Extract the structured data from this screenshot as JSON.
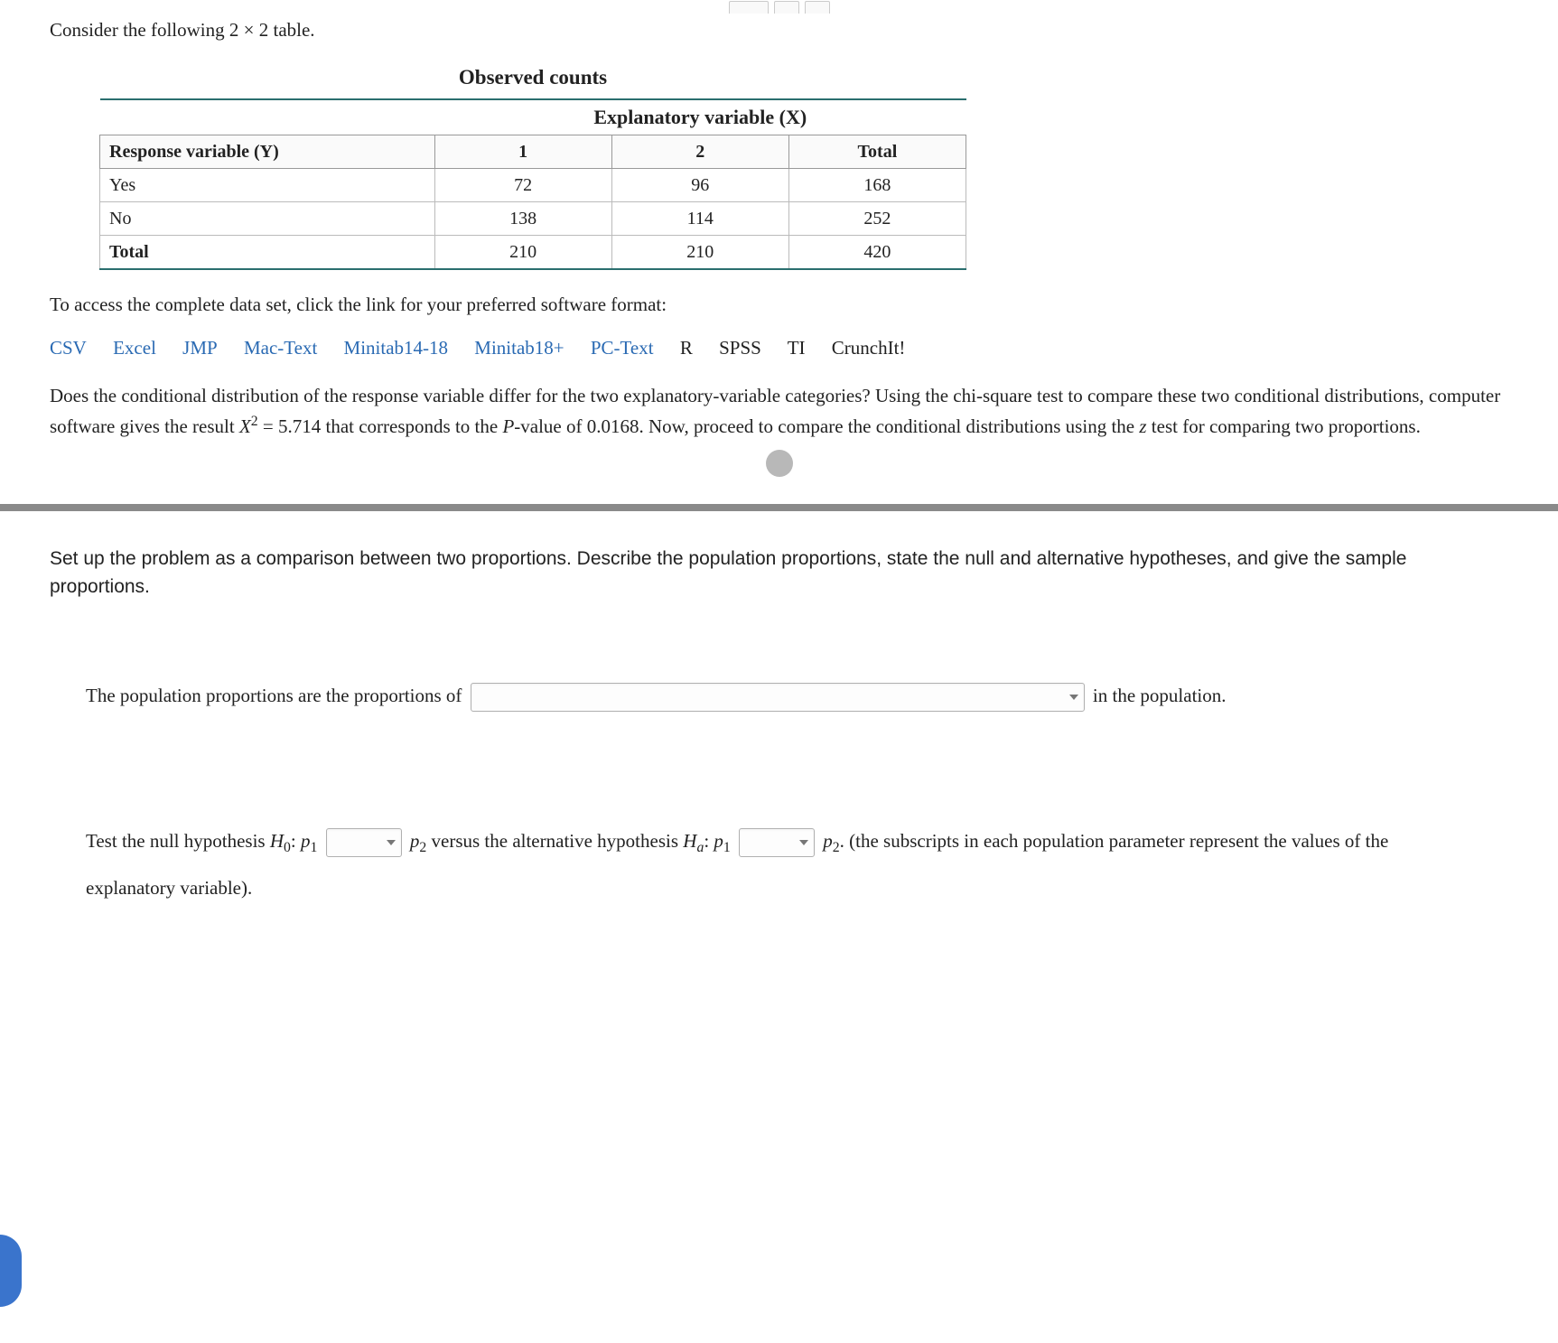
{
  "intro": "Consider the following 2 × 2 table.",
  "table": {
    "title": "Observed counts",
    "explanatory_header": "Explanatory variable (X)",
    "response_header": "Response variable (Y)",
    "col_headers": [
      "1",
      "2",
      "Total"
    ],
    "rows": [
      {
        "label": "Yes",
        "c1": "72",
        "c2": "96",
        "tot": "168"
      },
      {
        "label": "No",
        "c1": "138",
        "c2": "114",
        "tot": "252"
      },
      {
        "label": "Total",
        "c1": "210",
        "c2": "210",
        "tot": "420"
      }
    ]
  },
  "access_text": "To access the complete data set, click the link for your preferred software format:",
  "links": {
    "csv": "CSV",
    "excel": "Excel",
    "jmp": "JMP",
    "mactext": "Mac-Text",
    "minitab14": "Minitab14-18",
    "minitab18": "Minitab18+",
    "pctext": "PC-Text",
    "r": "R",
    "spss": "SPSS",
    "ti": "TI",
    "crunchit": "CrunchIt!"
  },
  "body_para": {
    "p1a": "Does the conditional distribution of the response variable differ for the two explanatory-variable categories? Using the chi-square test to compare these two conditional distributions, computer software gives the result ",
    "chi": "X",
    "eq": " = 5.714 that corresponds to the ",
    "pval_label": "P",
    "p1b": "-value of 0.0168. Now, proceed to compare the conditional distributions using the ",
    "zvar": "z",
    "p1c": " test for comparing two proportions."
  },
  "question": "Set up the problem as a comparison between two proportions. Describe the population proportions, state the null and alternative hypotheses, and give the sample proportions.",
  "answer1": {
    "pre": "The population proportions are the proportions of ",
    "post": " in the population."
  },
  "answer2": {
    "t1": "Test the null hypothesis ",
    "H0": "H",
    "sub0": "0",
    "colon": ": ",
    "p": "p",
    "sub1": "1",
    "sub2": "2",
    "versus": " versus the alternative hypothesis ",
    "Ha": "H",
    "suba": "a",
    "period": ". (the subscripts in each population parameter represent the values of the explanatory variable)."
  }
}
